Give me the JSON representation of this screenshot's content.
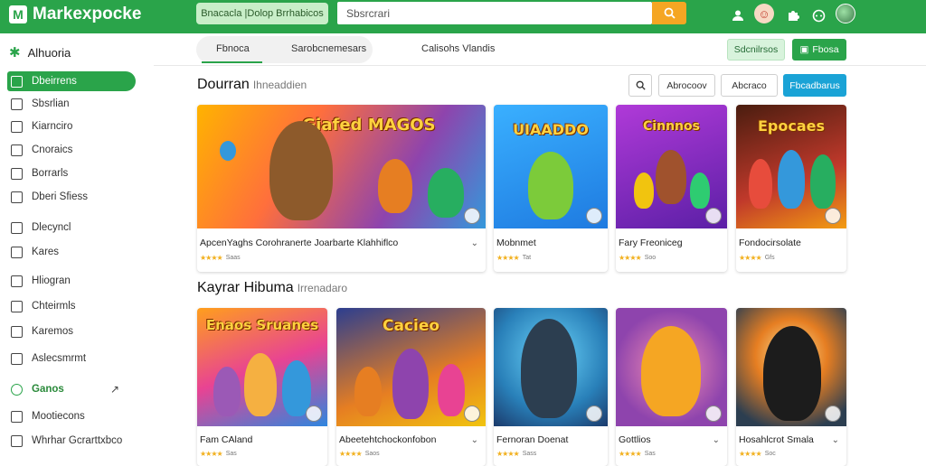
{
  "topbar": {
    "brand": "Markexpocke",
    "pill_label": "Bnacacla  |Dolop Brrhabicos",
    "search_value": "Sbsrcrari",
    "colors": {
      "bar": "#2aa44a",
      "search_button": "#f5a623"
    }
  },
  "sidebar": {
    "heading": "Alhuoria",
    "items": [
      {
        "label": "Dbeirrens",
        "icon": "square-icon",
        "active": true
      },
      {
        "label": "Sbsrlian",
        "icon": "square-icon"
      },
      {
        "label": "Kiarnciro",
        "icon": "square-icon"
      },
      {
        "label": "Cnoraics",
        "icon": "square-icon"
      },
      {
        "label": "Borrarls",
        "icon": "square-icon"
      },
      {
        "label": "Dberi Sfiess",
        "icon": "square-icon"
      },
      {
        "label": "Dlecyncl",
        "icon": "square-icon"
      },
      {
        "label": "Kares",
        "icon": "square-icon"
      },
      {
        "label": "Hliogran",
        "icon": "square-icon"
      },
      {
        "label": "Chteirmls",
        "icon": "square-icon"
      },
      {
        "label": "Karemos",
        "icon": "square-icon"
      },
      {
        "label": "Aslecsmrmt",
        "icon": "square-icon"
      },
      {
        "label": "Ganos",
        "icon": "circle-icon",
        "green": true
      },
      {
        "label": "Mootiecons",
        "icon": "square-icon"
      },
      {
        "label": "Whrhar Gcrarttxbco",
        "icon": "square-icon"
      }
    ]
  },
  "tabs": [
    {
      "label": "Fbnoca"
    },
    {
      "label": "Sarobcnemesars"
    },
    {
      "label": "Calisohs Vlandis"
    }
  ],
  "header_buttons": {
    "light": "Sdcnilrsos",
    "dark": "Fbosa"
  },
  "section1": {
    "title": "Dourran",
    "subtitle": "Ihneaddien",
    "filters": [
      "Abrocoov",
      "Abcraco",
      "Fbcadbarus"
    ],
    "cards": [
      {
        "title": "ApcenYaghs  Corohranerte  Joarbarte Klahhiflco",
        "rating_text": "Saas",
        "art_text": "Giafed MAGOS"
      },
      {
        "title": "Mobnmet",
        "rating_text": "Tat",
        "art_text": "UIAADDO"
      },
      {
        "title": "Fary Freoniceg",
        "rating_text": "Soo",
        "art_text": "Cinnnos"
      },
      {
        "title": "Fondocirsolate",
        "rating_text": "Gfs",
        "art_text": "Epocaes"
      }
    ]
  },
  "section2": {
    "title": "Kayrar Hibuma",
    "subtitle": "Irrenadaro",
    "cards": [
      {
        "title": "Fam CAland",
        "rating_text": "Sas",
        "art_text": "Enaos Sruanes"
      },
      {
        "title": "Abeetehtchockonfobon",
        "rating_text": "Saos",
        "art_text": "Cacieo"
      },
      {
        "title": "Fernoran Doenat",
        "rating_text": "Sass",
        "art_text": ""
      },
      {
        "title": "Gottlios",
        "rating_text": "Sas",
        "art_text": ""
      },
      {
        "title": "Hosahlcrot Smala",
        "rating_text": "Soc",
        "art_text": ""
      }
    ]
  }
}
